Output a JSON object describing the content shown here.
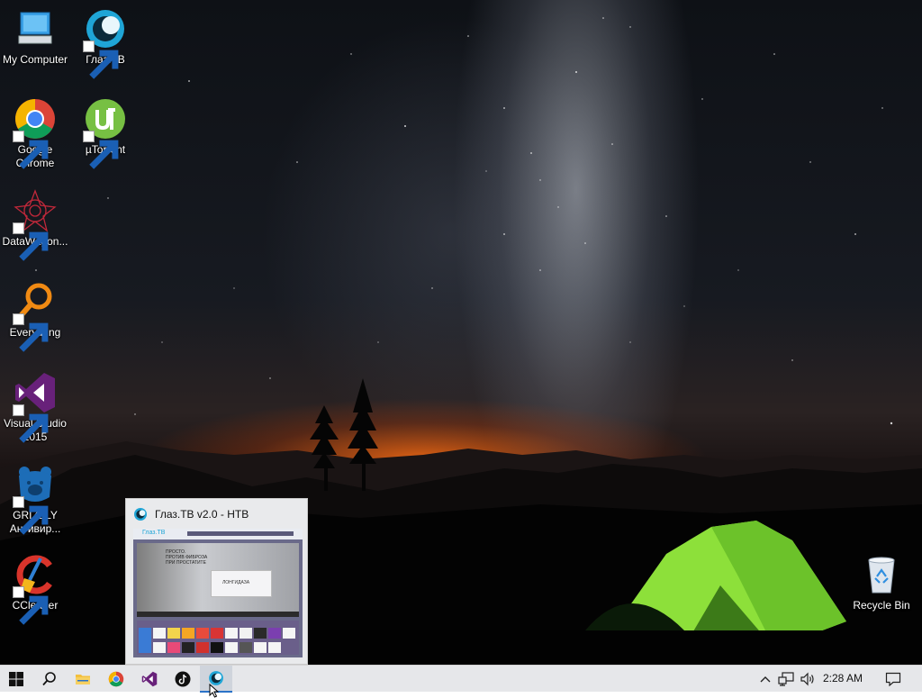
{
  "desktop": {
    "icons": [
      {
        "label": "My Computer",
        "icon": "computer-icon"
      },
      {
        "label": "Глаз.ТВ",
        "icon": "glaz-tv-icon"
      },
      {
        "label": "Google Chrome",
        "icon": "chrome-icon"
      },
      {
        "label": "µTorrent",
        "icon": "utorrent-icon"
      },
      {
        "label": "DataWagon...",
        "icon": "datawagon-icon"
      },
      {
        "label": "Everything",
        "icon": "everything-icon"
      },
      {
        "label": "Visual Studio 2015",
        "icon": "visual-studio-icon"
      },
      {
        "label": "GRIZZLY Антивир...",
        "icon": "grizzly-icon"
      },
      {
        "label": "CCleaner",
        "icon": "ccleaner-icon"
      },
      {
        "label": "Recycle Bin",
        "icon": "recycle-bin-icon"
      }
    ]
  },
  "thumbnail": {
    "title": "Глаз.ТВ v2.0 - НТВ",
    "icon": "glaz-tv-icon",
    "inner": {
      "brand": "Глаз.ТВ",
      "promo_line1": "ПРОСТО.",
      "promo_line2": "ПРОТИВ ФИБРОЗА",
      "promo_line3": "ПРИ ПРОСТАТИТЕ",
      "product": "ЛОНГИДАЗА"
    }
  },
  "taskbar": {
    "buttons": [
      {
        "name": "start-button",
        "icon": "windows-logo-icon"
      },
      {
        "name": "search-button",
        "icon": "search-icon"
      },
      {
        "name": "file-explorer-button",
        "icon": "folder-icon"
      },
      {
        "name": "chrome-taskbar-button",
        "icon": "chrome-icon"
      },
      {
        "name": "visual-studio-taskbar-button",
        "icon": "visual-studio-icon"
      },
      {
        "name": "tiktok-taskbar-button",
        "icon": "tiktok-icon"
      },
      {
        "name": "glaz-tv-taskbar-button",
        "icon": "glaz-tv-icon"
      }
    ],
    "tray": {
      "time": "2:28 AM"
    }
  },
  "colors": {
    "taskbar_bg": "#e6e7ea",
    "accent": "#2b73c8",
    "tent": "#8de03a"
  }
}
